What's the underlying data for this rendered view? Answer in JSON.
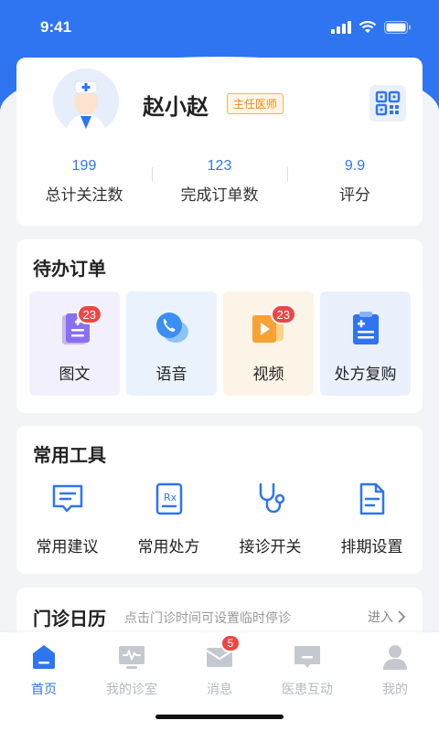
{
  "status_bar": {
    "time": "9:41"
  },
  "profile": {
    "name": "赵小赵",
    "title_badge": "主任医师",
    "stats": [
      {
        "value": "199",
        "label": "总计关注数"
      },
      {
        "value": "123",
        "label": "完成订单数"
      },
      {
        "value": "9.9",
        "label": "评分"
      }
    ]
  },
  "pending_orders": {
    "title": "待办订单",
    "items": [
      {
        "label": "图文",
        "badge": "23",
        "icon": "document-icon",
        "bg": "#f3f0fd"
      },
      {
        "label": "语音",
        "badge": "",
        "icon": "phone-chat-icon",
        "bg": "#eaf3fd"
      },
      {
        "label": "视频",
        "badge": "23",
        "icon": "video-icon",
        "bg": "#fdf4e8"
      },
      {
        "label": "处方复购",
        "badge": "",
        "icon": "prescription-icon",
        "bg": "#eaf1fd"
      }
    ]
  },
  "tools": {
    "title": "常用工具",
    "items": [
      {
        "label": "常用建议",
        "icon": "chat-suggestion-icon"
      },
      {
        "label": "常用处方",
        "icon": "rx-icon"
      },
      {
        "label": "接诊开关",
        "icon": "stethoscope-icon"
      },
      {
        "label": "排期设置",
        "icon": "schedule-doc-icon"
      }
    ]
  },
  "calendar": {
    "title": "门诊日历",
    "hint": "点击门诊时间可设置临时停诊",
    "enter": "进入"
  },
  "tabbar": {
    "items": [
      {
        "label": "首页",
        "active": true,
        "badge": ""
      },
      {
        "label": "我的诊室",
        "active": false,
        "badge": ""
      },
      {
        "label": "消息",
        "active": false,
        "badge": "5"
      },
      {
        "label": "医患互动",
        "active": false,
        "badge": ""
      },
      {
        "label": "我的",
        "active": false,
        "badge": ""
      }
    ]
  },
  "colors": {
    "primary": "#2f74f0",
    "badge": "#f04545",
    "title_badge": "#e58a1f"
  }
}
